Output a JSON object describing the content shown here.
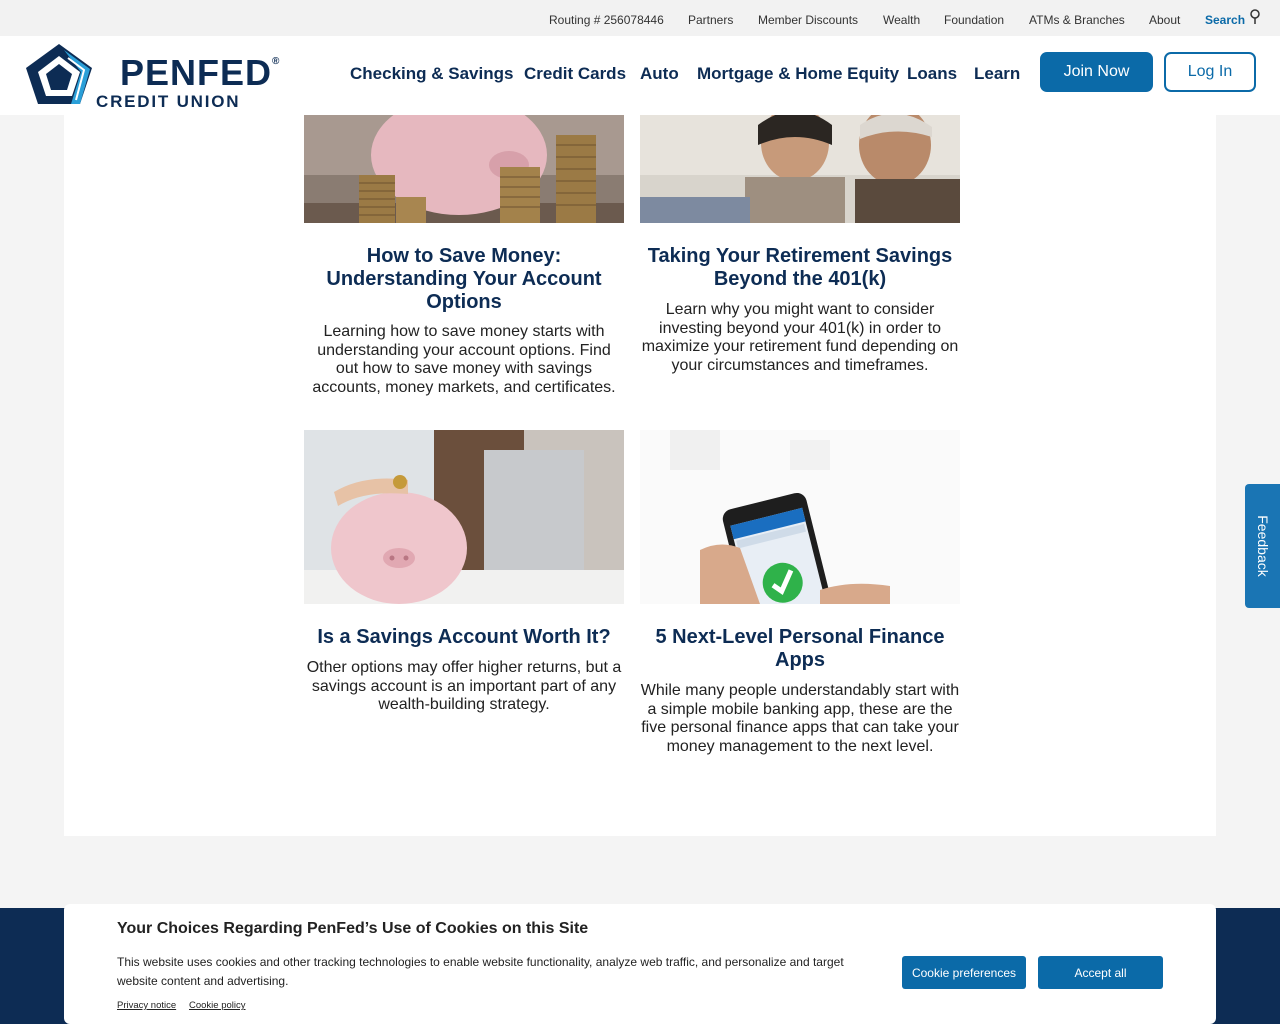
{
  "utility_nav": {
    "routing": "Routing # 256078446",
    "partners": "Partners",
    "member_discounts": "Member Discounts",
    "wealth": "Wealth",
    "foundation": "Foundation",
    "atms": "ATMs & Branches",
    "about": "About",
    "search": "Search"
  },
  "logo": {
    "word": "PENFED",
    "sub": "CREDIT UNION"
  },
  "main_nav": {
    "checking": "Checking & Savings",
    "credit_cards": "Credit Cards",
    "auto": "Auto",
    "mortgage": "Mortgage & Home Equity",
    "loans": "Loans",
    "learn": "Learn",
    "join": "Join Now",
    "login": "Log In"
  },
  "cards": [
    {
      "title": "How to Save Money: Understanding Your Account Options",
      "description": "Learning how to save money starts with understanding your account options. Find out how to save money with savings accounts, money markets, and certificates."
    },
    {
      "title": "Taking Your Retirement Savings Beyond the 401(k)",
      "description": "Learn why you might want to consider investing beyond your 401(k) in order to maximize your retirement fund depending on your circumstances and timeframes."
    },
    {
      "title": "Is a Savings Account Worth It?",
      "description": "Other options may offer higher returns, but a savings account is an important part of any wealth-building strategy."
    },
    {
      "title": "5 Next-Level Personal Finance Apps",
      "description": "While many people understandably start with a simple mobile banking app, these are the five personal finance apps that can take your money management to the next level."
    }
  ],
  "feedback": "Feedback",
  "cookie": {
    "title": "Your Choices Regarding PenFed’s Use of Cookies on this Site",
    "text": "This website uses cookies and other tracking technologies to enable website functionality, analyze web traffic, and personalize and target website content and advertising.",
    "privacy": "Privacy notice",
    "policy": "Cookie policy",
    "preferences": "Cookie preferences",
    "accept": "Accept all"
  },
  "colors": {
    "navy": "#0d2c54",
    "brand_blue": "#0b6aa8",
    "feedback_blue": "#1a75b4"
  }
}
